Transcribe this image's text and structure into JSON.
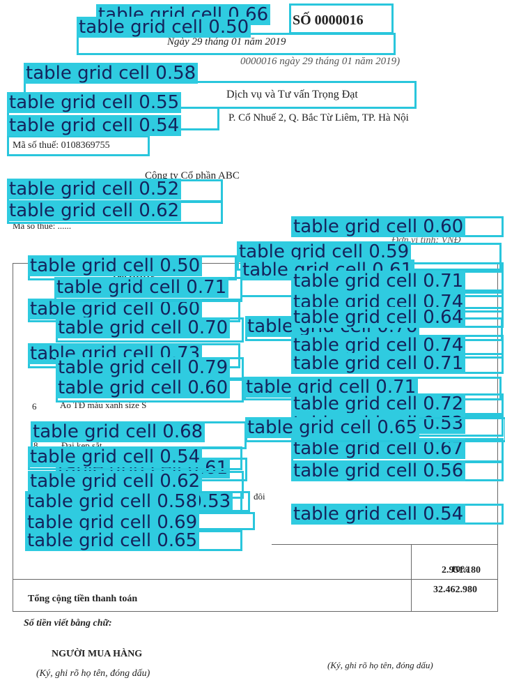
{
  "document": {
    "so_hd": "SỐ 0000016",
    "ngay": "Ngày 29 tháng 01 năm 2019",
    "ref_note": "0000016 ngày 29 tháng 01 năm 2019)",
    "seller_name": "Dịch vụ và Tư vấn Trọng Đạt",
    "seller_address": "P. Cổ Nhuế 2, Q. Bắc Từ Liêm, TP. Hà Nội",
    "seller_tax": "Mã số thuế: 0108369755",
    "buyer_name": "Công ty Cổ phần ABC",
    "buyer_tax": "Mã số thuế: ......",
    "currency": "Đơn vị tính: VNĐ",
    "col_name": "Tên HHDV",
    "item6_no": "6",
    "item6_name": "Áo TĐ màu xanh size S",
    "item8_no": "8",
    "item8_name": "Đai kẹp sắt",
    "item10_no": "10",
    "unit_doi": "đôi",
    "vat_rate": "10%",
    "vat_amount": "2.951.180",
    "total_label": "Tổng cộng tiền thanh toán",
    "total_value": "32.462.980",
    "words_label": "Số tiền viết bằng chữ:",
    "buyer_sign": "NGƯỜI MUA HÀNG",
    "buyer_sign_note": "(Ký, ghi rõ họ tên, đóng dấu)",
    "seller_sign_note": "(Ký, ghi rõ họ tên, đóng dấu)"
  },
  "detections": [
    {
      "label": "table grid cell 0.66"
    },
    {
      "label": "table grid cell 0.50"
    },
    {
      "label": "table grid cell 0.58"
    },
    {
      "label": "table grid cell 0.55"
    },
    {
      "label": "table grid cell 0.54"
    },
    {
      "label": "table grid cell 0.52"
    },
    {
      "label": "table grid cell 0.62"
    },
    {
      "label": "table grid cell 0.60"
    },
    {
      "label": "table grid cell 0.50"
    },
    {
      "label": "table grid cell 0.59"
    },
    {
      "label": "table grid cell 0.61"
    },
    {
      "label": "table grid cell 0.71"
    },
    {
      "label": "table grid cell 0.74"
    },
    {
      "label": "table grid cell 0.60"
    },
    {
      "label": "table grid cell 0.71"
    },
    {
      "label": "table grid cell 0.70"
    },
    {
      "label": "table grid cell 0.76"
    },
    {
      "label": "table grid cell 0.64"
    },
    {
      "label": "table grid cell 0.74"
    },
    {
      "label": "table grid cell 0.73"
    },
    {
      "label": "table grid cell 0.71"
    },
    {
      "label": "table grid cell 0.79"
    },
    {
      "label": "table grid cell 0.71"
    },
    {
      "label": "table grid cell 0.60"
    },
    {
      "label": "table grid cell 0.72"
    },
    {
      "label": "table grid cell 0.53"
    },
    {
      "label": "table grid cell 0.68"
    },
    {
      "label": "table grid cell 0.67"
    },
    {
      "label": "table grid cell 0.65"
    },
    {
      "label": "table grid cell 0.61"
    },
    {
      "label": "table grid cell 0.54"
    },
    {
      "label": "table grid cell 0.62"
    },
    {
      "label": "table grid cell 0.56"
    },
    {
      "label": "table grid cell 0.53"
    },
    {
      "label": "table grid cell 0.54"
    },
    {
      "label": "table grid cell 0.58"
    },
    {
      "label": "table grid cell 0.69"
    },
    {
      "label": "table grid cell 0.65"
    }
  ]
}
